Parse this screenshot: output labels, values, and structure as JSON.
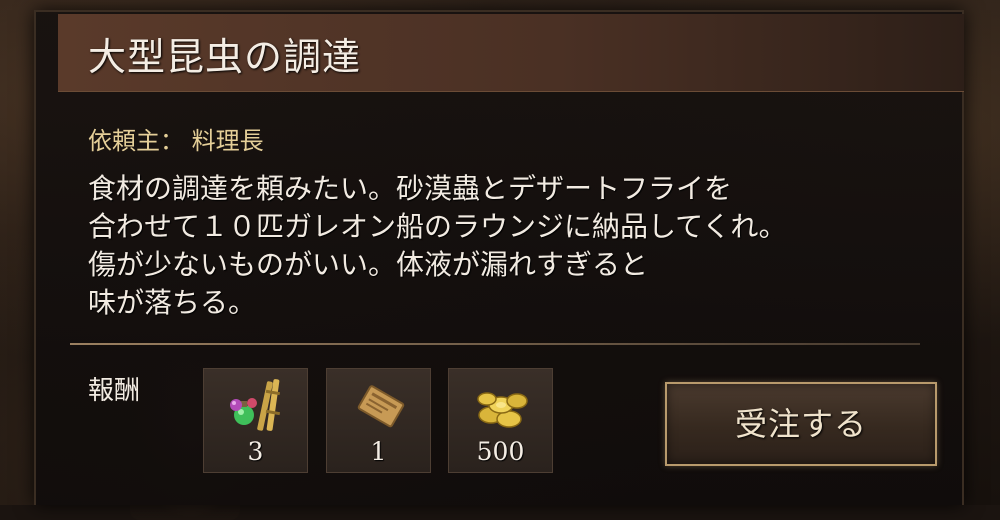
{
  "quest": {
    "title": "大型昆虫の調達",
    "client_label": "依頼主：",
    "client_name": "料理長",
    "description_lines": [
      "食材の調達を頼みたい。砂漠蟲とデザートフライを",
      "合わせて１０匹ガレオン船のラウンジに納品してくれ。",
      "傷が少ないものがいい。体液が漏れすぎると",
      "味が落ちる。"
    ]
  },
  "rewards": {
    "label": "報酬",
    "items": [
      {
        "icon": "potions-and-rods-icon",
        "count": "3"
      },
      {
        "icon": "ticket-icon",
        "count": "1"
      },
      {
        "icon": "gold-coins-icon",
        "count": "500"
      }
    ]
  },
  "actions": {
    "accept_label": "受注する"
  },
  "colors": {
    "title_bar": "#4a3024",
    "client_text": "#e5cf98",
    "body_text": "#f2ebe2",
    "button_border": "#b89a6c"
  }
}
